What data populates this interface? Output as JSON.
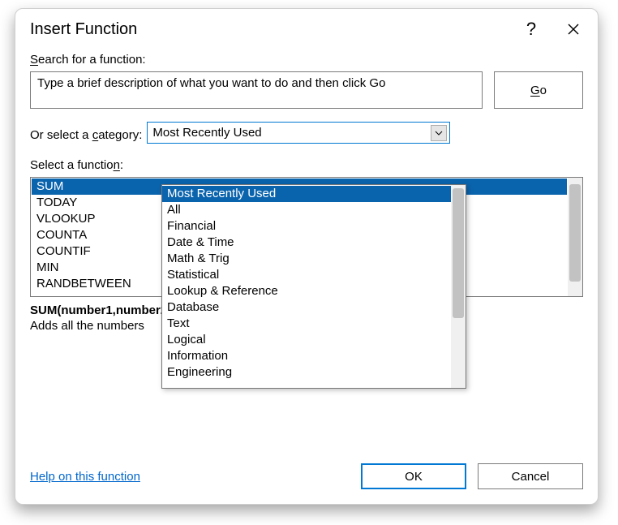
{
  "title": "Insert Function",
  "search_label_pre": "S",
  "search_label_rest": "earch for a function:",
  "search_value": "Type a brief description of what you want to do and then click Go",
  "go_label_pre": "G",
  "go_label_rest": "o",
  "category_label_pre": "Or select a ",
  "category_label_u": "c",
  "category_label_post": "ategory:",
  "category_selected": "Most Recently Used",
  "category_options": [
    "Most Recently Used",
    "All",
    "Financial",
    "Date & Time",
    "Math & Trig",
    "Statistical",
    "Lookup & Reference",
    "Database",
    "Text",
    "Logical",
    "Information",
    "Engineering"
  ],
  "select_func_pre": "Select a functio",
  "select_func_u": "n",
  "select_func_post": ":",
  "functions": [
    "SUM",
    "TODAY",
    "VLOOKUP",
    "COUNTA",
    "COUNTIF",
    "MIN",
    "RANDBETWEEN"
  ],
  "signature": "SUM(number1,number2,...)",
  "description_partial": "Adds all the numbers",
  "help_link": "Help on this function",
  "ok_label": "OK",
  "cancel_label": "Cancel"
}
